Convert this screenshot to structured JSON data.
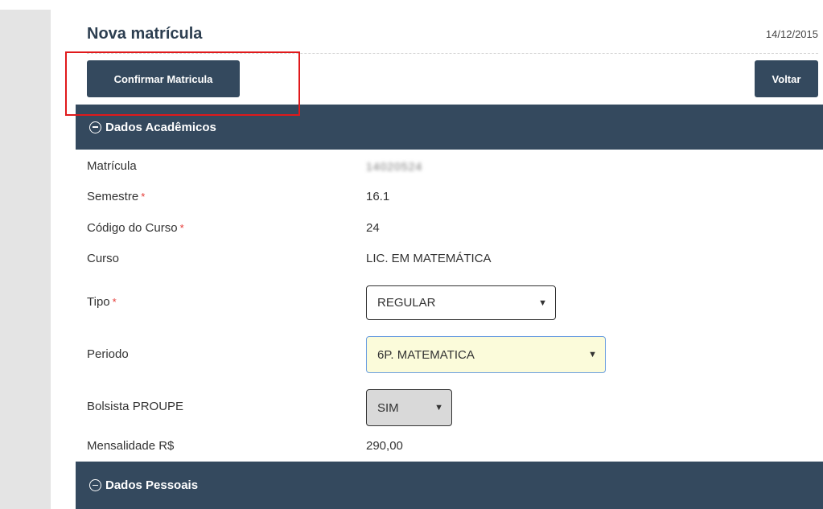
{
  "page": {
    "title": "Nova matrícula",
    "date": "14/12/2015"
  },
  "toolbar": {
    "confirm_label": "Confirmar Matricula",
    "back_label": "Voltar"
  },
  "sections": {
    "academic": {
      "label": "Dados Acadêmicos",
      "icon": "collapse-minus-icon"
    },
    "personal": {
      "label": "Dados Pessoais",
      "icon": "collapse-minus-icon"
    }
  },
  "fields": {
    "matricula": {
      "label": "Matrícula",
      "value": "14020524"
    },
    "semestre": {
      "label": "Semestre",
      "required": "*",
      "value": "16.1"
    },
    "codigo_curso": {
      "label": "Código do Curso",
      "required": "*",
      "value": "24"
    },
    "curso": {
      "label": "Curso",
      "value": "LIC. EM MATEMÁTICA"
    },
    "tipo": {
      "label": "Tipo",
      "required": "*",
      "value": "REGULAR"
    },
    "periodo": {
      "label": "Periodo",
      "value": "6P. MATEMATICA"
    },
    "bolsista": {
      "label": "Bolsista PROUPE",
      "value": "SIM"
    },
    "mensalidade": {
      "label": "Mensalidade R$",
      "value": "290,00"
    }
  },
  "colors": {
    "header_bg": "#34495e",
    "highlight": "#e0191b",
    "required": "#e53935",
    "periodo_bg": "#fbfbda"
  }
}
